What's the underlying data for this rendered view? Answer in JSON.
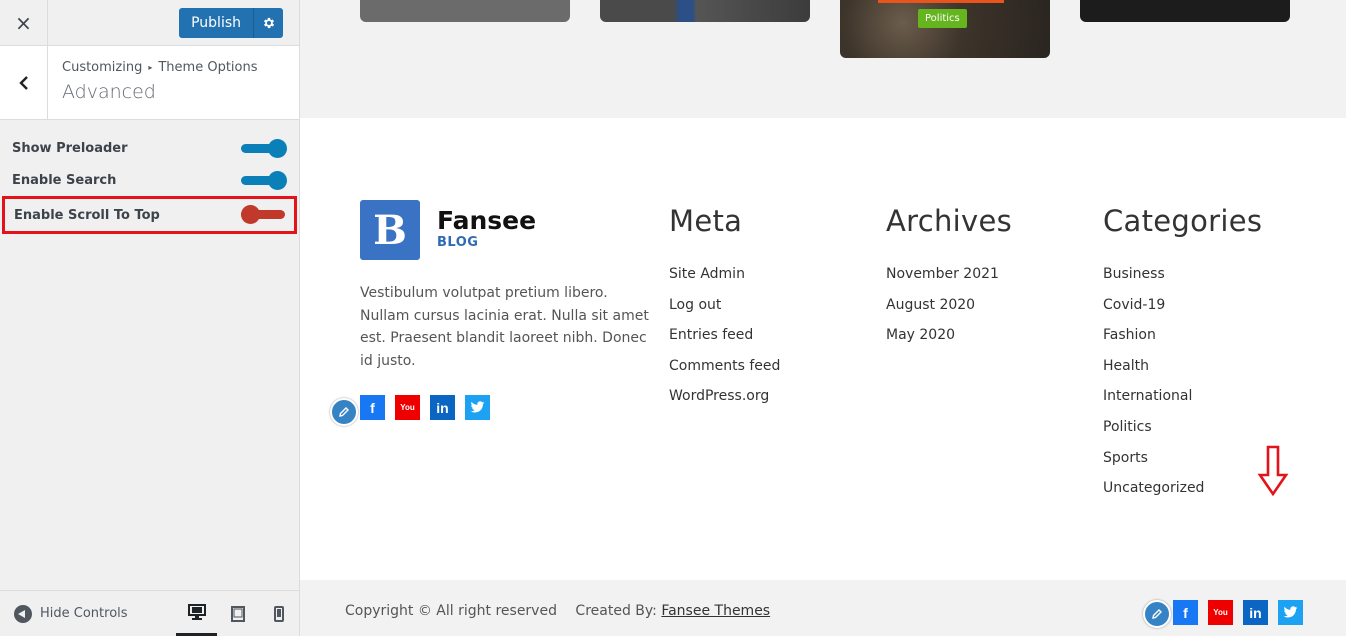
{
  "sidebar": {
    "close_label": "×",
    "publish_label": "Publish",
    "breadcrumb": {
      "root": "Customizing",
      "separator": "▸",
      "parent": "Theme Options"
    },
    "section_title": "Advanced",
    "options": [
      {
        "label": "Show Preloader",
        "state": "on"
      },
      {
        "label": "Enable Search",
        "state": "on"
      },
      {
        "label": "Enable Scroll To Top",
        "state": "off",
        "highlighted": true
      }
    ],
    "hide_controls_label": "Hide Controls",
    "devices": [
      "desktop",
      "tablet",
      "mobile"
    ],
    "active_device": "desktop"
  },
  "preview": {
    "post_badge": "Politics",
    "brand": {
      "logo_letter": "B",
      "name": "Fansee",
      "tagline": "BLOG"
    },
    "about_text": "Vestibulum volutpat pretium libero. Nullam cursus lacinia erat. Nulla sit amet est. Praesent blandit laoreet nibh. Donec id justo.",
    "widgets": {
      "meta": {
        "title": "Meta",
        "items": [
          "Site Admin",
          "Log out",
          "Entries feed",
          "Comments feed",
          "WordPress.org"
        ]
      },
      "archives": {
        "title": "Archives",
        "items": [
          "November 2021",
          "August 2020",
          "May 2020"
        ]
      },
      "categories": {
        "title": "Categories",
        "items": [
          "Business",
          "Covid-19",
          "Fashion",
          "Health",
          "International",
          "Politics",
          "Sports",
          "Uncategorized"
        ]
      }
    },
    "social": [
      {
        "name": "facebook",
        "glyph": "f"
      },
      {
        "name": "youtube",
        "glyph": "You"
      },
      {
        "name": "linkedin",
        "glyph": "in"
      },
      {
        "name": "twitter",
        "glyph": "t"
      }
    ],
    "footer": {
      "copyright": "Copyright © All right reserved",
      "created_by": "Created By:",
      "created_link": "Fansee Themes"
    }
  },
  "colors": {
    "accent": "#2271b1",
    "toggle_on": "#0a7fb8",
    "toggle_off": "#c0392b",
    "highlight_box": "#e3121b",
    "badge": "#64b51e",
    "logo_bg": "#3a73c4"
  }
}
